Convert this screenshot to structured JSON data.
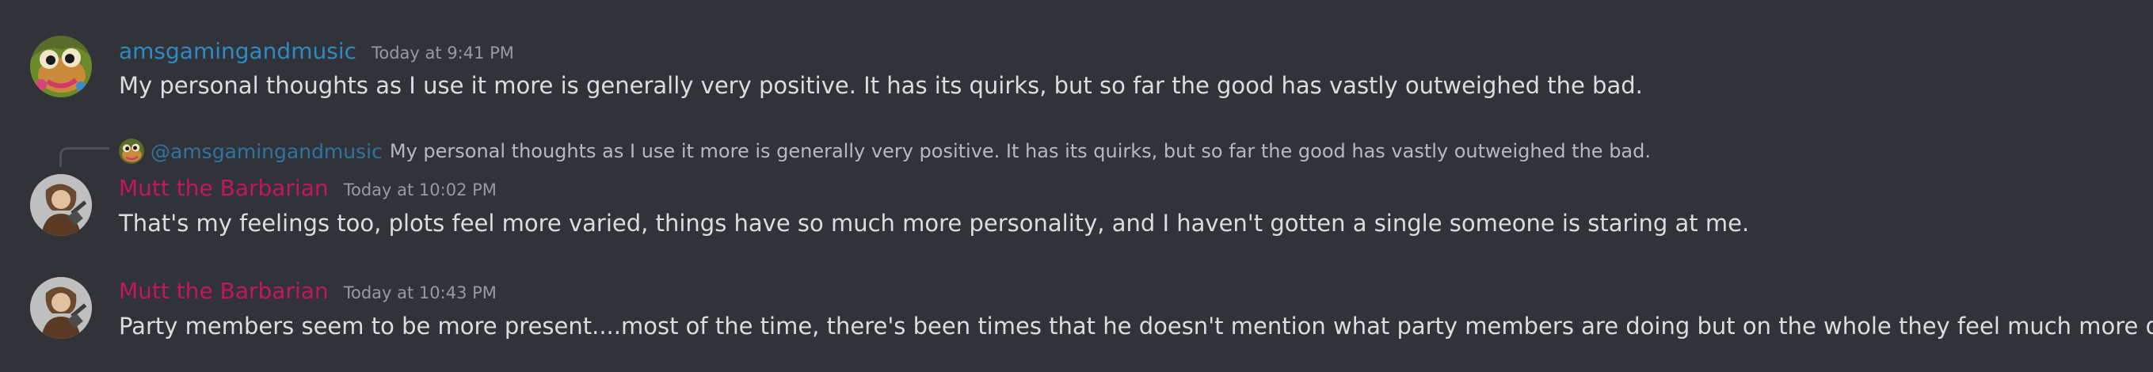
{
  "messages": [
    {
      "username": "amsgamingandmusic",
      "timestamp": "Today at 9:41 PM",
      "avatar_icon": "frog-avatar-icon",
      "username_color": "#2d8ac4",
      "content": "My personal thoughts as I use it more is generally very positive. It has its quirks, but so far the good has vastly outweighed the bad."
    },
    {
      "reply": {
        "username": "@amsgamingandmusic",
        "content": "My personal thoughts as I use it more is generally very positive. It has its quirks, but so far the good has vastly outweighed the bad."
      },
      "username": "Mutt the Barbarian",
      "timestamp": "Today at 10:02 PM",
      "avatar_icon": "barbarian-avatar-icon",
      "username_color": "#c2185b",
      "content": "That's my feelings too, plots feel more varied, things have so much more personality, and I haven't gotten a single someone is staring at me."
    },
    {
      "username": "Mutt the Barbarian",
      "timestamp": "Today at 10:43 PM",
      "avatar_icon": "barbarian-avatar-icon",
      "username_color": "#c2185b",
      "content": "Party members seem to be more present....most of the time, there's been times that he doesn't mention what party members are doing but on the whole they feel much more dynamic."
    }
  ],
  "colors": {
    "background": "#313338",
    "message_text": "#dbdee1",
    "timestamp": "#949ba4",
    "reply_text": "#b5bac1"
  }
}
